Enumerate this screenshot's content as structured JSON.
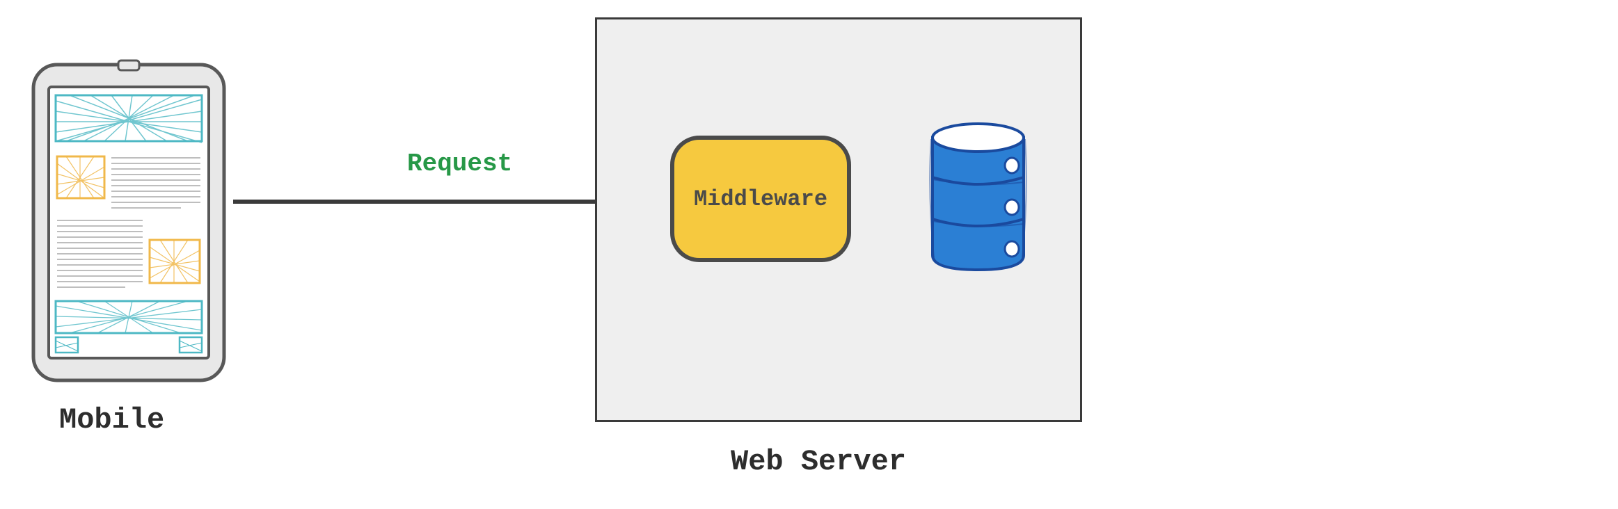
{
  "diagram": {
    "mobile": {
      "label": "Mobile"
    },
    "arrow": {
      "label": "Request"
    },
    "server": {
      "label": "Web Server",
      "middleware": {
        "label": "Middleware"
      }
    }
  },
  "colors": {
    "arrow_label": "#279847",
    "middleware_fill": "#f6c93f",
    "middleware_border": "#4a4a4a",
    "server_bg": "#efefef",
    "database_fill": "#2b7fd4",
    "mobile_accent_teal": "#4db8c4",
    "mobile_accent_orange": "#f0b84a"
  }
}
